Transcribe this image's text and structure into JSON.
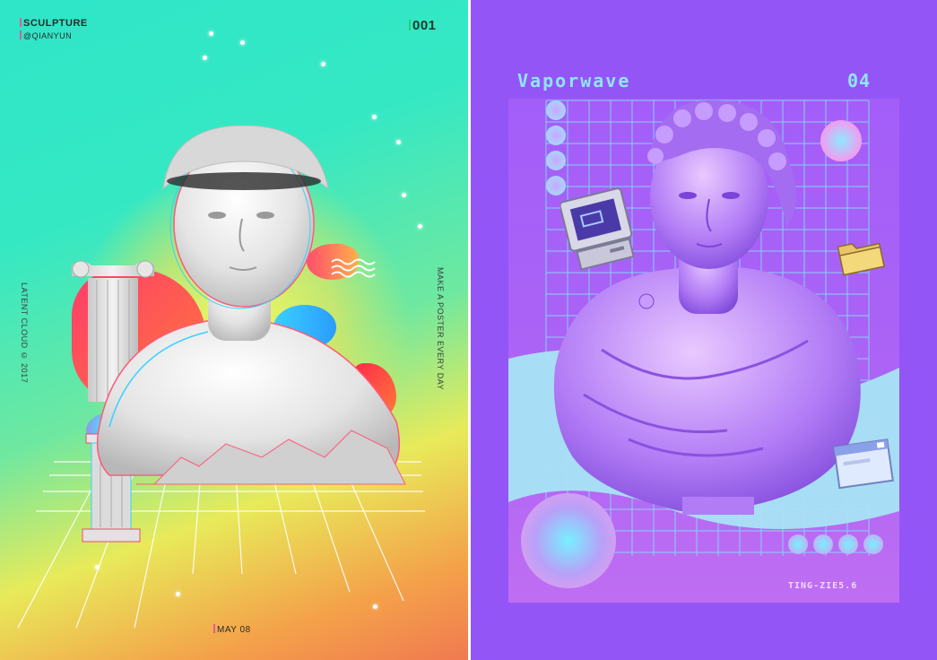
{
  "left_poster": {
    "title": "SCULPTURE",
    "handle": "@QIANYUN",
    "number": "001",
    "side_left_text": "LATENT CLOUD © 2017",
    "side_right_text": "MAKE A POSTER EVERY DAY",
    "date": "MAY 08"
  },
  "right_poster": {
    "title": "Vaporwave",
    "number": "04",
    "signature": "TING-ZIE5.6"
  },
  "colors": {
    "left_bg_top": "#2fe6c8",
    "left_bg_bottom": "#f07a50",
    "right_bg": "#9455f7",
    "right_accent": "#8fe6f8"
  }
}
